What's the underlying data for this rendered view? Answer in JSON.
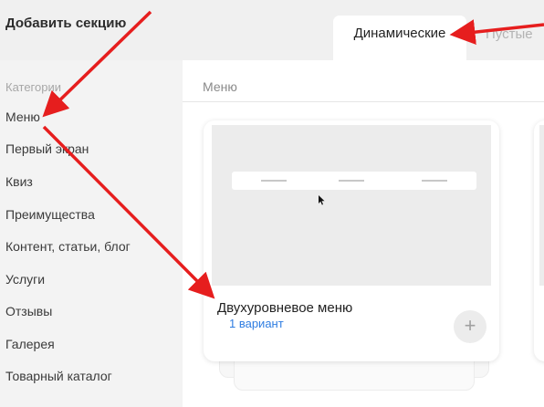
{
  "header": {
    "title": "Добавить секцию",
    "tabs": [
      {
        "label": "Динамические",
        "active": true
      },
      {
        "label": "Пустые",
        "active": false
      }
    ]
  },
  "sidebar": {
    "heading": "Категории",
    "items": [
      {
        "label": "Меню"
      },
      {
        "label": "Первый экран"
      },
      {
        "label": "Квиз"
      },
      {
        "label": "Преимущества"
      },
      {
        "label": "Контент, статьи, блог"
      },
      {
        "label": "Услуги"
      },
      {
        "label": "Отзывы"
      },
      {
        "label": "Галерея"
      },
      {
        "label": "Товарный каталог"
      }
    ]
  },
  "main": {
    "heading": "Меню",
    "card": {
      "title": "Двухуровневое меню",
      "variant": "1 вариант",
      "add_label": "+"
    }
  },
  "colors": {
    "accent_link": "#2f7de1",
    "annotation_arrow": "#e61e1e"
  },
  "icons": {
    "add": "plus-icon",
    "cursor": "mouse-cursor-icon",
    "annotation": "red-arrow-annotation"
  }
}
